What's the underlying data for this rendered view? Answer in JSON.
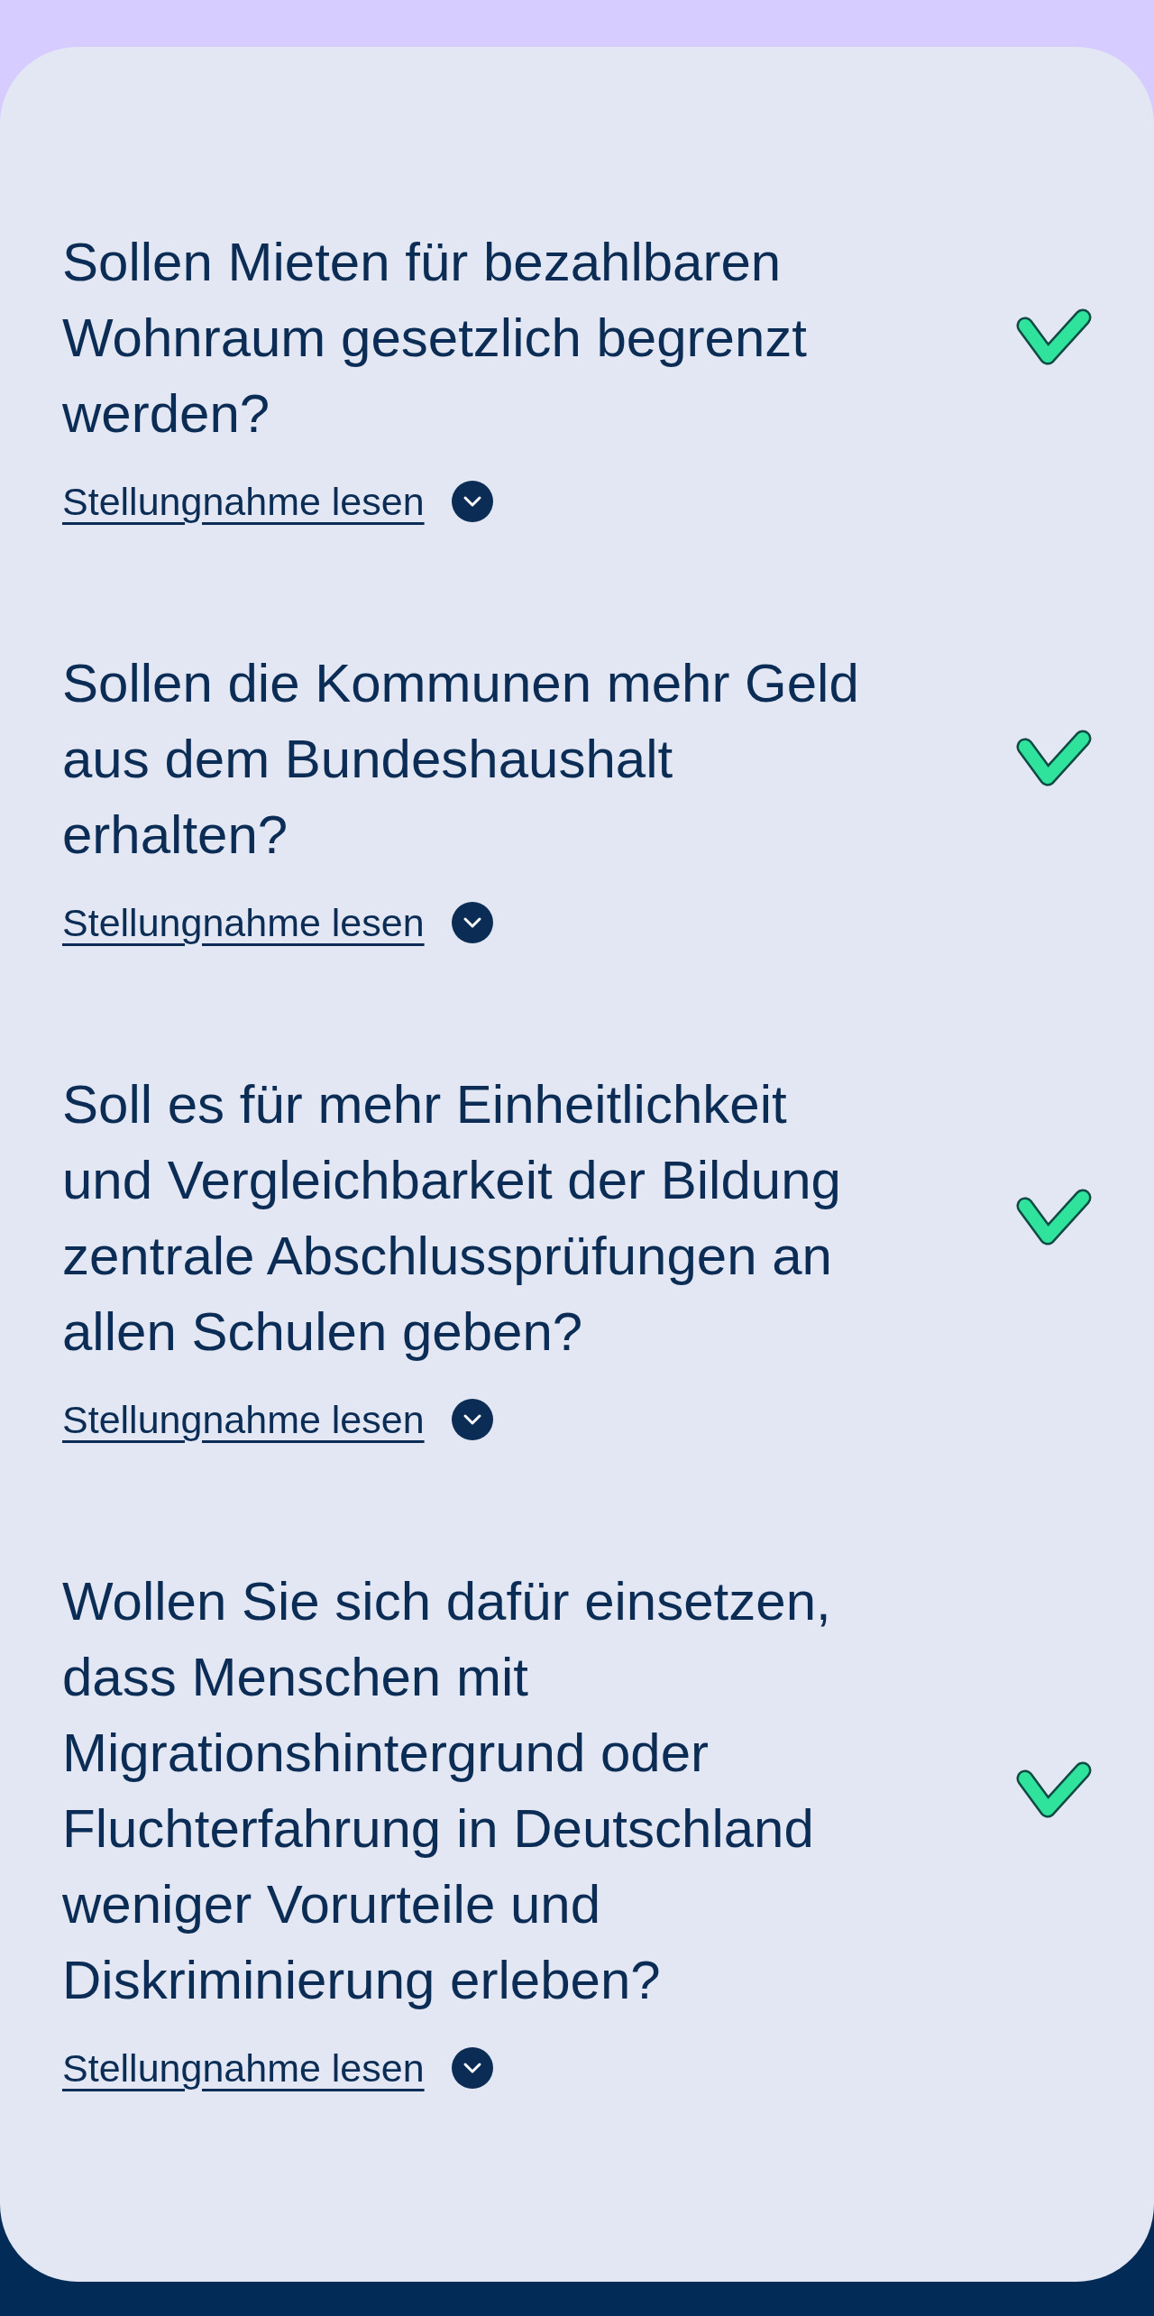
{
  "questions": [
    {
      "text": "Sollen Mieten für bezahlbaren Wohnraum gesetzlich begrenzt werden?",
      "agreed": true,
      "statement_link": {
        "label": "Stellungnahme lesen",
        "expanded": false
      }
    },
    {
      "text": "Sollen die Kommunen mehr Geld aus dem Bundeshaushalt erhalten?",
      "agreed": true,
      "statement_link": {
        "label": "Stellungnahme lesen",
        "expanded": false
      }
    },
    {
      "text": "Soll es für mehr Einheitlichkeit und Vergleichbarkeit der Bildung zentrale Abschlussprüfungen an allen Schulen geben?",
      "agreed": true,
      "statement_link": {
        "label": "Stellungnahme lesen",
        "expanded": false
      }
    },
    {
      "text": "Wollen Sie sich dafür einsetzen, dass Menschen mit Migrationshintergrund oder Fluchterfahrung in Deutschland weniger Vorurteile und Diskriminierung erleben?",
      "agreed": true,
      "statement_link": {
        "label": "Stellungnahme lesen",
        "expanded": false
      }
    }
  ]
}
